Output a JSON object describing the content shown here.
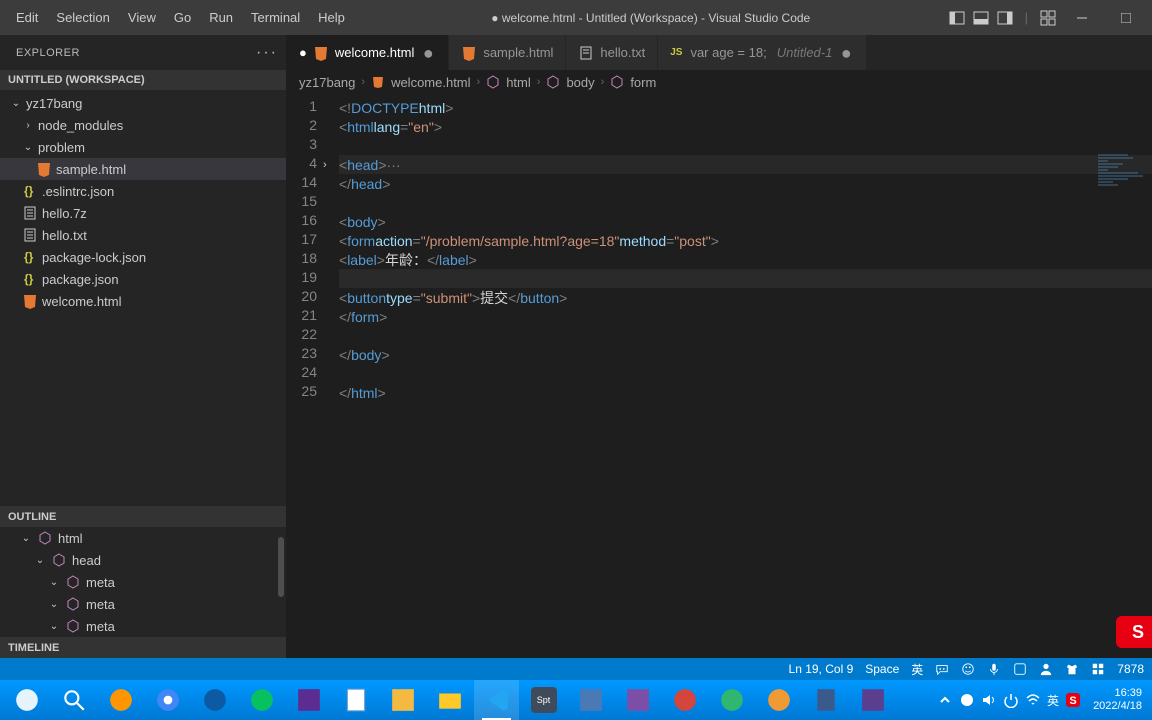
{
  "titlebar": {
    "menus": [
      "Edit",
      "Selection",
      "View",
      "Go",
      "Run",
      "Terminal",
      "Help"
    ],
    "title": "● welcome.html - Untitled (Workspace) - Visual Studio Code"
  },
  "sidebar": {
    "header": "EXPLORER",
    "workspace_label": "UNTITLED (WORKSPACE)",
    "tree": [
      {
        "type": "folder",
        "open": true,
        "indent": 0,
        "name": "yz17bang"
      },
      {
        "type": "folder",
        "open": false,
        "indent": 1,
        "name": "node_modules"
      },
      {
        "type": "folder",
        "open": true,
        "indent": 1,
        "name": "problem"
      },
      {
        "type": "file",
        "icon": "html",
        "indent": 2,
        "name": "sample.html",
        "selected": true
      },
      {
        "type": "file",
        "icon": "json",
        "indent": 1,
        "name": ".eslintrc.json"
      },
      {
        "type": "file",
        "icon": "txt",
        "indent": 1,
        "name": "hello.7z"
      },
      {
        "type": "file",
        "icon": "txt",
        "indent": 1,
        "name": "hello.txt"
      },
      {
        "type": "file",
        "icon": "json",
        "indent": 1,
        "name": "package-lock.json"
      },
      {
        "type": "file",
        "icon": "json",
        "indent": 1,
        "name": "package.json"
      },
      {
        "type": "file",
        "icon": "html",
        "indent": 1,
        "name": "welcome.html"
      }
    ],
    "outline": {
      "label": "OUTLINE",
      "items": [
        {
          "indent": 0,
          "name": "html"
        },
        {
          "indent": 1,
          "name": "head"
        },
        {
          "indent": 2,
          "name": "meta"
        },
        {
          "indent": 2,
          "name": "meta"
        },
        {
          "indent": 2,
          "name": "meta"
        }
      ]
    },
    "timeline_label": "TIMELINE"
  },
  "tabs": [
    {
      "icon": "html",
      "label": "welcome.html",
      "modified": true,
      "active": true
    },
    {
      "icon": "html",
      "label": "sample.html"
    },
    {
      "icon": "txt",
      "label": "hello.txt"
    },
    {
      "icon": "js",
      "label": "var age = 18;",
      "secondary": "Untitled-1",
      "modified": true
    }
  ],
  "breadcrumb": [
    "yz17bang",
    "welcome.html",
    "html",
    "body",
    "form"
  ],
  "code": {
    "lines": [
      {
        "n": 1,
        "html": "<span class='tk-pu'>&lt;!</span><span class='tk-tag'>DOCTYPE</span> <span class='tk-attr'>html</span><span class='tk-pu'>&gt;</span>"
      },
      {
        "n": 2,
        "html": "<span class='tk-pu'>&lt;</span><span class='tk-tag'>html</span> <span class='tk-attr'>lang</span><span class='tk-pu'>=</span><span class='tk-str'>\"en\"</span><span class='tk-pu'>&gt;</span>"
      },
      {
        "n": 3,
        "html": ""
      },
      {
        "n": 4,
        "fold": true,
        "hl": true,
        "html": "<span class='tk-pu'>&lt;</span><span class='tk-tag'>head</span><span class='tk-pu'>&gt;</span> <span class='tk-dots'>···</span>"
      },
      {
        "n": 14,
        "html": "<span class='tk-pu'>&lt;/</span><span class='tk-tag'>head</span><span class='tk-pu'>&gt;</span>"
      },
      {
        "n": 15,
        "html": ""
      },
      {
        "n": 16,
        "html": "<span class='tk-pu'>&lt;</span><span class='tk-tag'>body</span><span class='tk-pu'>&gt;</span>"
      },
      {
        "n": 17,
        "html": "    <span class='tk-pu'>&lt;</span><span class='tk-tag'>form</span> <span class='tk-attr'>action</span><span class='tk-pu'>=</span><span class='tk-str'>\"/problem/sample.html?age=18\"</span> <span class='tk-attr'>method</span><span class='tk-pu'>=</span><span class='tk-str'>\"post\"</span><span class='tk-pu'>&gt;</span>"
      },
      {
        "n": 18,
        "html": "        <span class='tk-pu'>&lt;</span><span class='tk-tag'>label</span><span class='tk-pu'>&gt;</span><span class='tk-txt'>年龄：</span><span class='tk-pu'>&lt;/</span><span class='tk-tag'>label</span><span class='tk-pu'>&gt;</span>"
      },
      {
        "n": 19,
        "cur": true,
        "html": "        "
      },
      {
        "n": 20,
        "html": "        <span class='tk-pu'>&lt;</span><span class='tk-tag'>button</span> <span class='tk-attr'>type</span><span class='tk-pu'>=</span><span class='tk-str'>\"submit\"</span><span class='tk-pu'>&gt;</span><span class='tk-txt'>提交</span><span class='tk-pu'>&lt;/</span><span class='tk-tag'>button</span><span class='tk-pu'>&gt;</span>"
      },
      {
        "n": 21,
        "html": "    <span class='tk-pu'>&lt;/</span><span class='tk-tag'>form</span><span class='tk-pu'>&gt;</span>"
      },
      {
        "n": 22,
        "html": ""
      },
      {
        "n": 23,
        "html": "<span class='tk-pu'>&lt;/</span><span class='tk-tag'>body</span><span class='tk-pu'>&gt;</span>"
      },
      {
        "n": 24,
        "html": ""
      },
      {
        "n": 25,
        "html": "<span class='tk-pu'>&lt;/</span><span class='tk-tag'>html</span><span class='tk-pu'>&gt;</span>"
      }
    ]
  },
  "statusbar": {
    "lncol": "Ln 19, Col 9",
    "spaces": "Space",
    "port": "7878"
  },
  "ime": {
    "label": "英"
  },
  "clock": {
    "time": "16:39",
    "date": "2022/4/18"
  }
}
